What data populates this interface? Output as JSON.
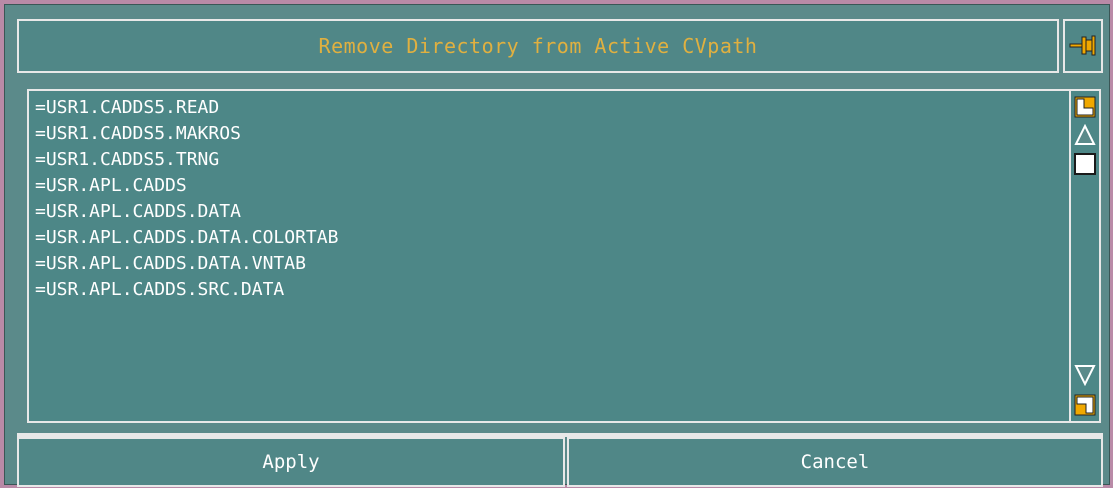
{
  "dialog": {
    "title": "Remove Directory from Active CVpath",
    "pin_icon": "pushpin-icon"
  },
  "list": {
    "items": [
      "=USR1.CADDS5.READ",
      "=USR1.CADDS5.MAKROS",
      "=USR1.CADDS5.TRNG",
      "=USR.APL.CADDS",
      "=USR.APL.CADDS.DATA",
      "=USR.APL.CADDS.DATA.COLORTAB",
      "=USR.APL.CADDS.DATA.VNTAB",
      "=USR.APL.CADDS.SRC.DATA"
    ]
  },
  "scrollbar": {
    "top_icon": "scroll-to-top-icon",
    "up_icon": "scroll-up-arrow-icon",
    "down_icon": "scroll-down-arrow-icon",
    "bottom_icon": "scroll-to-bottom-icon",
    "scroll_position": 0
  },
  "buttons": {
    "apply": "Apply",
    "cancel": "Cancel"
  },
  "colors": {
    "panel": "#5b8a8a",
    "title_text": "#e0b040",
    "accent": "#f0a800",
    "frame": "#b98aa7"
  }
}
